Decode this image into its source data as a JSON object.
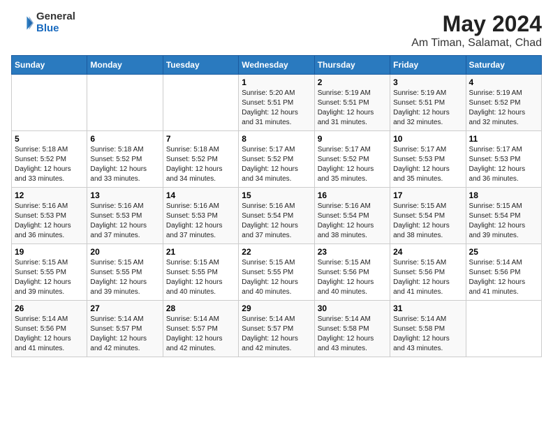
{
  "header": {
    "logo": {
      "general": "General",
      "blue": "Blue"
    },
    "title": "May 2024",
    "subtitle": "Am Timan, Salamat, Chad"
  },
  "days_of_week": [
    "Sunday",
    "Monday",
    "Tuesday",
    "Wednesday",
    "Thursday",
    "Friday",
    "Saturday"
  ],
  "weeks": [
    [
      {
        "day": "",
        "info": ""
      },
      {
        "day": "",
        "info": ""
      },
      {
        "day": "",
        "info": ""
      },
      {
        "day": "1",
        "info": "Sunrise: 5:20 AM\nSunset: 5:51 PM\nDaylight: 12 hours and 31 minutes."
      },
      {
        "day": "2",
        "info": "Sunrise: 5:19 AM\nSunset: 5:51 PM\nDaylight: 12 hours and 31 minutes."
      },
      {
        "day": "3",
        "info": "Sunrise: 5:19 AM\nSunset: 5:51 PM\nDaylight: 12 hours and 32 minutes."
      },
      {
        "day": "4",
        "info": "Sunrise: 5:19 AM\nSunset: 5:52 PM\nDaylight: 12 hours and 32 minutes."
      }
    ],
    [
      {
        "day": "5",
        "info": "Sunrise: 5:18 AM\nSunset: 5:52 PM\nDaylight: 12 hours and 33 minutes."
      },
      {
        "day": "6",
        "info": "Sunrise: 5:18 AM\nSunset: 5:52 PM\nDaylight: 12 hours and 33 minutes."
      },
      {
        "day": "7",
        "info": "Sunrise: 5:18 AM\nSunset: 5:52 PM\nDaylight: 12 hours and 34 minutes."
      },
      {
        "day": "8",
        "info": "Sunrise: 5:17 AM\nSunset: 5:52 PM\nDaylight: 12 hours and 34 minutes."
      },
      {
        "day": "9",
        "info": "Sunrise: 5:17 AM\nSunset: 5:52 PM\nDaylight: 12 hours and 35 minutes."
      },
      {
        "day": "10",
        "info": "Sunrise: 5:17 AM\nSunset: 5:53 PM\nDaylight: 12 hours and 35 minutes."
      },
      {
        "day": "11",
        "info": "Sunrise: 5:17 AM\nSunset: 5:53 PM\nDaylight: 12 hours and 36 minutes."
      }
    ],
    [
      {
        "day": "12",
        "info": "Sunrise: 5:16 AM\nSunset: 5:53 PM\nDaylight: 12 hours and 36 minutes."
      },
      {
        "day": "13",
        "info": "Sunrise: 5:16 AM\nSunset: 5:53 PM\nDaylight: 12 hours and 37 minutes."
      },
      {
        "day": "14",
        "info": "Sunrise: 5:16 AM\nSunset: 5:53 PM\nDaylight: 12 hours and 37 minutes."
      },
      {
        "day": "15",
        "info": "Sunrise: 5:16 AM\nSunset: 5:54 PM\nDaylight: 12 hours and 37 minutes."
      },
      {
        "day": "16",
        "info": "Sunrise: 5:16 AM\nSunset: 5:54 PM\nDaylight: 12 hours and 38 minutes."
      },
      {
        "day": "17",
        "info": "Sunrise: 5:15 AM\nSunset: 5:54 PM\nDaylight: 12 hours and 38 minutes."
      },
      {
        "day": "18",
        "info": "Sunrise: 5:15 AM\nSunset: 5:54 PM\nDaylight: 12 hours and 39 minutes."
      }
    ],
    [
      {
        "day": "19",
        "info": "Sunrise: 5:15 AM\nSunset: 5:55 PM\nDaylight: 12 hours and 39 minutes."
      },
      {
        "day": "20",
        "info": "Sunrise: 5:15 AM\nSunset: 5:55 PM\nDaylight: 12 hours and 39 minutes."
      },
      {
        "day": "21",
        "info": "Sunrise: 5:15 AM\nSunset: 5:55 PM\nDaylight: 12 hours and 40 minutes."
      },
      {
        "day": "22",
        "info": "Sunrise: 5:15 AM\nSunset: 5:55 PM\nDaylight: 12 hours and 40 minutes."
      },
      {
        "day": "23",
        "info": "Sunrise: 5:15 AM\nSunset: 5:56 PM\nDaylight: 12 hours and 40 minutes."
      },
      {
        "day": "24",
        "info": "Sunrise: 5:15 AM\nSunset: 5:56 PM\nDaylight: 12 hours and 41 minutes."
      },
      {
        "day": "25",
        "info": "Sunrise: 5:14 AM\nSunset: 5:56 PM\nDaylight: 12 hours and 41 minutes."
      }
    ],
    [
      {
        "day": "26",
        "info": "Sunrise: 5:14 AM\nSunset: 5:56 PM\nDaylight: 12 hours and 41 minutes."
      },
      {
        "day": "27",
        "info": "Sunrise: 5:14 AM\nSunset: 5:57 PM\nDaylight: 12 hours and 42 minutes."
      },
      {
        "day": "28",
        "info": "Sunrise: 5:14 AM\nSunset: 5:57 PM\nDaylight: 12 hours and 42 minutes."
      },
      {
        "day": "29",
        "info": "Sunrise: 5:14 AM\nSunset: 5:57 PM\nDaylight: 12 hours and 42 minutes."
      },
      {
        "day": "30",
        "info": "Sunrise: 5:14 AM\nSunset: 5:58 PM\nDaylight: 12 hours and 43 minutes."
      },
      {
        "day": "31",
        "info": "Sunrise: 5:14 AM\nSunset: 5:58 PM\nDaylight: 12 hours and 43 minutes."
      },
      {
        "day": "",
        "info": ""
      }
    ]
  ]
}
